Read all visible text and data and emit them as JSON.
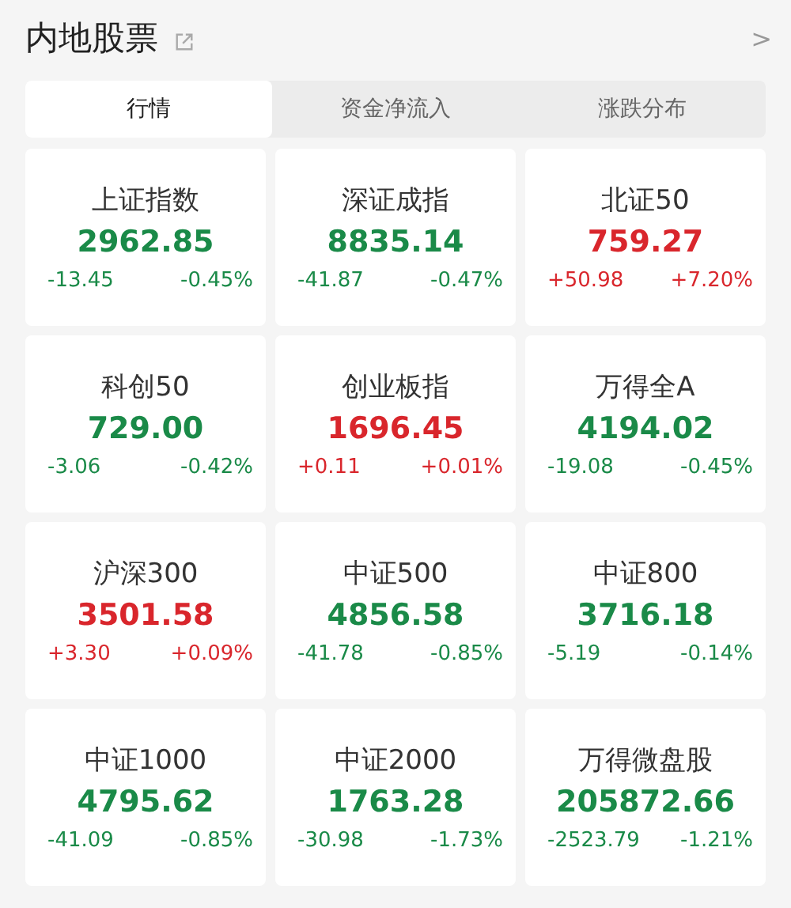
{
  "header": {
    "title": "内地股票",
    "chevron": ">"
  },
  "tabs": [
    {
      "label": "行情",
      "selected": true
    },
    {
      "label": "资金净流入",
      "selected": false
    },
    {
      "label": "涨跌分布",
      "selected": false
    }
  ],
  "indices": [
    {
      "name": "上证指数",
      "value": "2962.85",
      "change": "-13.45",
      "percent": "-0.45%",
      "rising": false
    },
    {
      "name": "深证成指",
      "value": "8835.14",
      "change": "-41.87",
      "percent": "-0.47%",
      "rising": false
    },
    {
      "name": "北证50",
      "value": "759.27",
      "change": "+50.98",
      "percent": "+7.20%",
      "rising": true
    },
    {
      "name": "科创50",
      "value": "729.00",
      "change": "-3.06",
      "percent": "-0.42%",
      "rising": false
    },
    {
      "name": "创业板指",
      "value": "1696.45",
      "change": "+0.11",
      "percent": "+0.01%",
      "rising": true
    },
    {
      "name": "万得全A",
      "value": "4194.02",
      "change": "-19.08",
      "percent": "-0.45%",
      "rising": false
    },
    {
      "name": "沪深300",
      "value": "3501.58",
      "change": "+3.30",
      "percent": "+0.09%",
      "rising": true
    },
    {
      "name": "中证500",
      "value": "4856.58",
      "change": "-41.78",
      "percent": "-0.85%",
      "rising": false
    },
    {
      "name": "中证800",
      "value": "3716.18",
      "change": "-5.19",
      "percent": "-0.14%",
      "rising": false
    },
    {
      "name": "中证1000",
      "value": "4795.62",
      "change": "-41.09",
      "percent": "-0.85%",
      "rising": false
    },
    {
      "name": "中证2000",
      "value": "1763.28",
      "change": "-30.98",
      "percent": "-1.73%",
      "rising": false
    },
    {
      "name": "万得微盘股",
      "value": "205872.66",
      "change": "-2523.79",
      "percent": "-1.21%",
      "rising": false
    }
  ]
}
